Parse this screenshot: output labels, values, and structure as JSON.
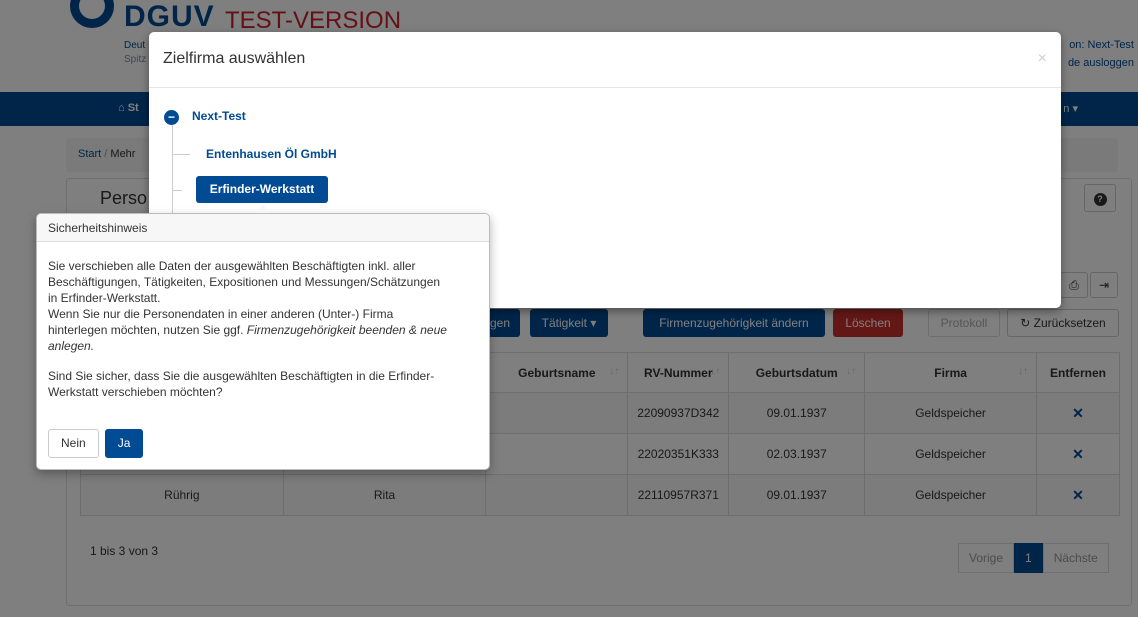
{
  "header": {
    "logo_text": "DGUV",
    "test_label": "TEST-VERSION",
    "sub1": "Deut",
    "sub2": "Spitz",
    "user_line1": "on: Next-Test",
    "user_line2": "de ausloggen"
  },
  "navbar": {
    "home_label": "St",
    "right_label": "n ▾"
  },
  "breadcrumb": {
    "start": "Start",
    "sep": " / ",
    "current": "Mehr"
  },
  "panel": {
    "title": "Perso",
    "help_icon": "?"
  },
  "toolbar": {
    "btn_partial": "gen",
    "taetigkeit": "Tätigkeit ▾",
    "firmenzugehoerigkeit": "Firmenzugehörigkeit ändern",
    "loeschen": "Löschen",
    "protokoll": "Protokoll",
    "zuruecksetzen": "↻ Zurücksetzen",
    "print_icon": "⎙",
    "export_icon": "⇥"
  },
  "table": {
    "columns": [
      "",
      "",
      "Geburtsname",
      "RV-Nummer",
      "Geburtsdatum",
      "Firma",
      "Entfernen"
    ],
    "rows": [
      [
        "",
        "",
        "",
        "22090937D342",
        "09.01.1937",
        "Geldspeicher",
        "✕"
      ],
      [
        "",
        "",
        "",
        "22020351K333",
        "02.03.1937",
        "Geldspeicher",
        "✕"
      ],
      [
        "Rührig",
        "Rita",
        "",
        "22110957R371",
        "09.01.1937",
        "Geldspeicher",
        "✕"
      ]
    ]
  },
  "footer": {
    "info": "1 bis 3 von 3",
    "prev": "Vorige",
    "page": "1",
    "next": "Nächste"
  },
  "modal": {
    "title": "Zielfirma auswählen",
    "close": "×",
    "tree": {
      "root": "Next-Test",
      "root_icon": "−",
      "child1": "Entenhausen Öl GmbH",
      "child2_selected": "Erfinder-Werkstatt"
    }
  },
  "popover": {
    "title": "Sicherheitshinweis",
    "line1": "Sie verschieben alle Daten der ausgewählten Beschäftigten inkl. aller",
    "line2": "Beschäftigungen, Tätigkeiten, Expositionen und Messungen/Schätzungen",
    "line3": "in Erfinder-Werkstatt.",
    "line4": "Wenn Sie nur die Personendaten in einer anderen (Unter-) Firma",
    "line5_a": "hinterlegen möchten, nutzen Sie ggf. ",
    "line5_b": "Firmenzugehörigkeit beenden & neue",
    "line6": "anlegen.",
    "line7": "Sind Sie sicher, dass Sie die ausgewählten Beschäftigten in die Erfinder-",
    "line8": "Werkstatt verschieben möchten?",
    "no_label": "Nein",
    "yes_label": "Ja"
  }
}
